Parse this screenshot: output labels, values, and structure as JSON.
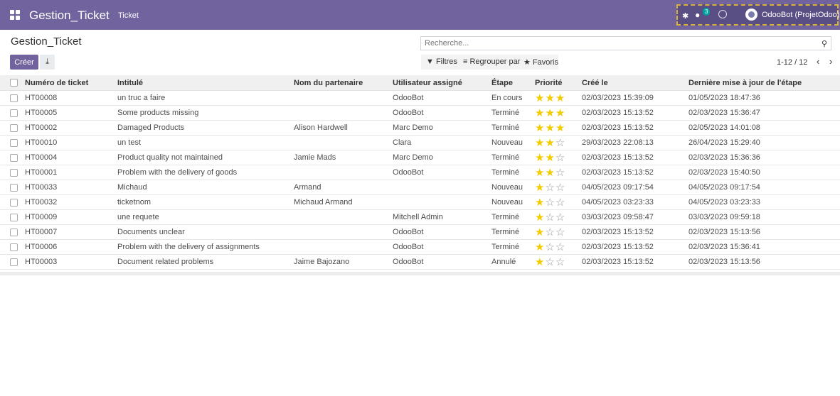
{
  "navbar": {
    "app_name": "Gestion_Ticket",
    "menu_item": "Ticket",
    "chat_count": "3",
    "user_name": "OdooBot (ProjetOdoo)",
    "color": "#71639e"
  },
  "control_panel": {
    "title": "Gestion_Ticket",
    "search_placeholder": "Recherche...",
    "create_label": "Créer",
    "filters_label": "Filtres",
    "group_by_label": "Regrouper par",
    "favorites_label": "Favoris",
    "pager_value": "1-12 / 12"
  },
  "table": {
    "columns": [
      "Numéro de ticket",
      "Intitulé",
      "Nom du partenaire",
      "Utilisateur assigné",
      "Étape",
      "Priorité",
      "Créé le",
      "Dernière mise à jour de l'étape"
    ],
    "rows": [
      {
        "number": "HT00008",
        "title": "un truc a faire",
        "partner": "",
        "user": "OdooBot",
        "stage": "En cours",
        "priority": 3,
        "created": "02/03/2023 15:39:09",
        "updated": "01/05/2023 18:47:36"
      },
      {
        "number": "HT00005",
        "title": "Some products missing",
        "partner": "",
        "user": "OdooBot",
        "stage": "Terminé",
        "priority": 3,
        "created": "02/03/2023 15:13:52",
        "updated": "02/03/2023 15:36:47"
      },
      {
        "number": "HT00002",
        "title": "Damaged Products",
        "partner": "Alison Hardwell",
        "user": "Marc Demo",
        "stage": "Terminé",
        "priority": 3,
        "created": "02/03/2023 15:13:52",
        "updated": "02/05/2023 14:01:08"
      },
      {
        "number": "HT00010",
        "title": "un test",
        "partner": "",
        "user": "Clara",
        "stage": "Nouveau",
        "priority": 2,
        "created": "29/03/2023 22:08:13",
        "updated": "26/04/2023 15:29:40"
      },
      {
        "number": "HT00004",
        "title": "Product quality not maintained",
        "partner": "Jamie Mads",
        "user": "Marc Demo",
        "stage": "Terminé",
        "priority": 2,
        "created": "02/03/2023 15:13:52",
        "updated": "02/03/2023 15:36:36"
      },
      {
        "number": "HT00001",
        "title": "Problem with the delivery of goods",
        "partner": "",
        "user": "OdooBot",
        "stage": "Terminé",
        "priority": 2,
        "created": "02/03/2023 15:13:52",
        "updated": "02/03/2023 15:40:50"
      },
      {
        "number": "HT00033",
        "title": "Michaud",
        "partner": "Armand",
        "user": "",
        "stage": "Nouveau",
        "priority": 1,
        "created": "04/05/2023 09:17:54",
        "updated": "04/05/2023 09:17:54"
      },
      {
        "number": "HT00032",
        "title": "ticketnom",
        "partner": "Michaud Armand",
        "user": "",
        "stage": "Nouveau",
        "priority": 1,
        "created": "04/05/2023 03:23:33",
        "updated": "04/05/2023 03:23:33"
      },
      {
        "number": "HT00009",
        "title": "une requete",
        "partner": "",
        "user": "Mitchell Admin",
        "stage": "Terminé",
        "priority": 1,
        "created": "03/03/2023 09:58:47",
        "updated": "03/03/2023 09:59:18"
      },
      {
        "number": "HT00007",
        "title": "Documents unclear",
        "partner": "",
        "user": "OdooBot",
        "stage": "Terminé",
        "priority": 1,
        "created": "02/03/2023 15:13:52",
        "updated": "02/03/2023 15:13:56"
      },
      {
        "number": "HT00006",
        "title": "Problem with the delivery of assignments",
        "partner": "",
        "user": "OdooBot",
        "stage": "Terminé",
        "priority": 1,
        "created": "02/03/2023 15:13:52",
        "updated": "02/03/2023 15:36:41"
      },
      {
        "number": "HT00003",
        "title": "Document related problems",
        "partner": "Jaime Bajozano",
        "user": "OdooBot",
        "stage": "Annulé",
        "priority": 1,
        "created": "02/03/2023 15:13:52",
        "updated": "02/03/2023 15:13:56"
      }
    ]
  }
}
